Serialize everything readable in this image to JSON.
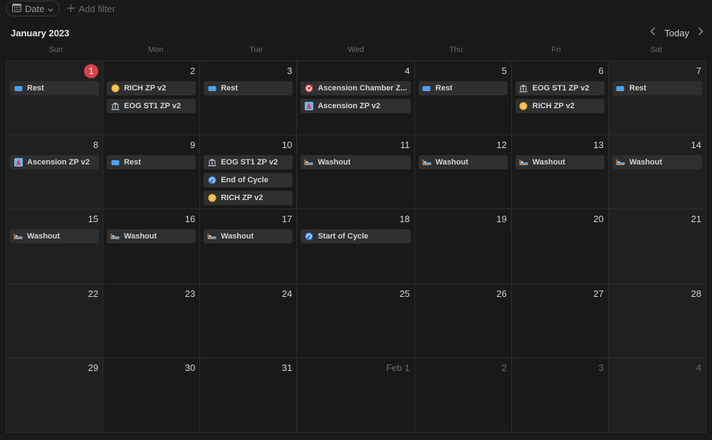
{
  "toolbar": {
    "date_label": "Date",
    "add_filter_label": "Add filter"
  },
  "header": {
    "month_title": "January 2023",
    "today_label": "Today"
  },
  "weekdays": [
    "Sun",
    "Mon",
    "Tue",
    "Wed",
    "Thu",
    "Fri",
    "Sat"
  ],
  "today": 1,
  "days": [
    {
      "label": "1",
      "today": true,
      "events": [
        {
          "icon": "rest",
          "label": "Rest"
        }
      ]
    },
    {
      "label": "2",
      "events": [
        {
          "icon": "coin",
          "label": "RICH ZP v2"
        },
        {
          "icon": "bank",
          "label": "EOG ST1 ZP v2"
        }
      ]
    },
    {
      "label": "3",
      "events": [
        {
          "icon": "rest",
          "label": "Rest"
        }
      ]
    },
    {
      "label": "4",
      "events": [
        {
          "icon": "target",
          "label": "Ascension Chamber Z..."
        },
        {
          "icon": "rocket",
          "label": "Ascension ZP v2"
        }
      ]
    },
    {
      "label": "5",
      "events": [
        {
          "icon": "rest",
          "label": "Rest"
        }
      ]
    },
    {
      "label": "6",
      "events": [
        {
          "icon": "bank",
          "label": "EOG ST1 ZP v2"
        },
        {
          "icon": "coin",
          "label": "RICH ZP v2"
        }
      ]
    },
    {
      "label": "7",
      "events": [
        {
          "icon": "rest",
          "label": "Rest"
        }
      ]
    },
    {
      "label": "8",
      "events": [
        {
          "icon": "rocket",
          "label": "Ascension ZP v2"
        }
      ]
    },
    {
      "label": "9",
      "events": [
        {
          "icon": "rest",
          "label": "Rest"
        }
      ]
    },
    {
      "label": "10",
      "events": [
        {
          "icon": "bank",
          "label": "EOG ST1 ZP v2"
        },
        {
          "icon": "cycle",
          "label": "End of Cycle"
        },
        {
          "icon": "coin",
          "label": "RICH ZP v2"
        }
      ]
    },
    {
      "label": "11",
      "events": [
        {
          "icon": "bed",
          "label": "Washout"
        }
      ]
    },
    {
      "label": "12",
      "events": [
        {
          "icon": "bed",
          "label": "Washout"
        }
      ]
    },
    {
      "label": "13",
      "events": [
        {
          "icon": "bed",
          "label": "Washout"
        }
      ]
    },
    {
      "label": "14",
      "events": [
        {
          "icon": "bed",
          "label": "Washout"
        }
      ]
    },
    {
      "label": "15",
      "events": [
        {
          "icon": "bed",
          "label": "Washout"
        }
      ]
    },
    {
      "label": "16",
      "events": [
        {
          "icon": "bed",
          "label": "Washout"
        }
      ]
    },
    {
      "label": "17",
      "events": [
        {
          "icon": "bed",
          "label": "Washout"
        }
      ]
    },
    {
      "label": "18",
      "events": [
        {
          "icon": "cycle",
          "label": "Start of Cycle"
        }
      ]
    },
    {
      "label": "19",
      "events": []
    },
    {
      "label": "20",
      "events": []
    },
    {
      "label": "21",
      "events": []
    },
    {
      "label": "22",
      "events": []
    },
    {
      "label": "23",
      "events": []
    },
    {
      "label": "24",
      "events": []
    },
    {
      "label": "25",
      "events": []
    },
    {
      "label": "26",
      "events": []
    },
    {
      "label": "27",
      "events": []
    },
    {
      "label": "28",
      "events": []
    },
    {
      "label": "29",
      "events": []
    },
    {
      "label": "30",
      "events": []
    },
    {
      "label": "31",
      "events": []
    },
    {
      "label": "Feb 1",
      "other": true,
      "events": []
    },
    {
      "label": "2",
      "other": true,
      "events": []
    },
    {
      "label": "3",
      "other": true,
      "events": []
    },
    {
      "label": "4",
      "other": true,
      "events": []
    }
  ],
  "icons": {
    "rest": "rest-icon",
    "coin": "coin-icon",
    "bank": "bank-icon",
    "target": "target-icon",
    "rocket": "rocket-icon",
    "cycle": "cycle-icon",
    "bed": "bed-icon"
  },
  "colors": {
    "today_badge": "#d9414a",
    "event_bg": "#2f2f2f",
    "weekend_bg": "#202020",
    "background": "#191919"
  }
}
